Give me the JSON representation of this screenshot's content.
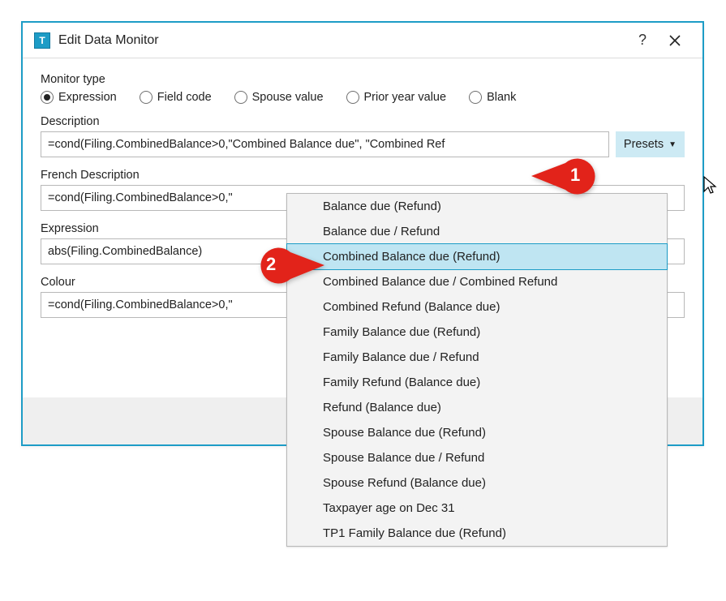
{
  "window": {
    "title": "Edit Data Monitor",
    "help": "?",
    "app_icon_letter": "T"
  },
  "monitor_type": {
    "label": "Monitor type",
    "options": [
      "Expression",
      "Field code",
      "Spouse value",
      "Prior year value",
      "Blank"
    ],
    "selected_index": 0
  },
  "fields": {
    "description": {
      "label": "Description",
      "value": "=cond(Filing.CombinedBalance>0,\"Combined Balance due\", \"Combined Ref",
      "presets_label": "Presets"
    },
    "french_description": {
      "label": "French Description",
      "value": "=cond(Filing.CombinedBalance>0,\""
    },
    "expression": {
      "label": "Expression",
      "value": "abs(Filing.CombinedBalance)"
    },
    "colour": {
      "label": "Colour",
      "value": "=cond(Filing.CombinedBalance>0,\""
    }
  },
  "presets_dropdown": {
    "items": [
      "Balance due (Refund)",
      "Balance due / Refund",
      "Combined Balance due (Refund)",
      "Combined Balance due / Combined Refund",
      "Combined Refund (Balance due)",
      "Family Balance due (Refund)",
      "Family Balance due / Refund",
      "Family Refund (Balance due)",
      "Refund (Balance due)",
      "Spouse Balance due (Refund)",
      "Spouse Balance due / Refund",
      "Spouse Refund (Balance due)",
      "Taxpayer age on Dec 31",
      "TP1 Family Balance due (Refund)"
    ],
    "selected_index": 2
  },
  "callouts": {
    "c1": "1",
    "c2": "2"
  }
}
